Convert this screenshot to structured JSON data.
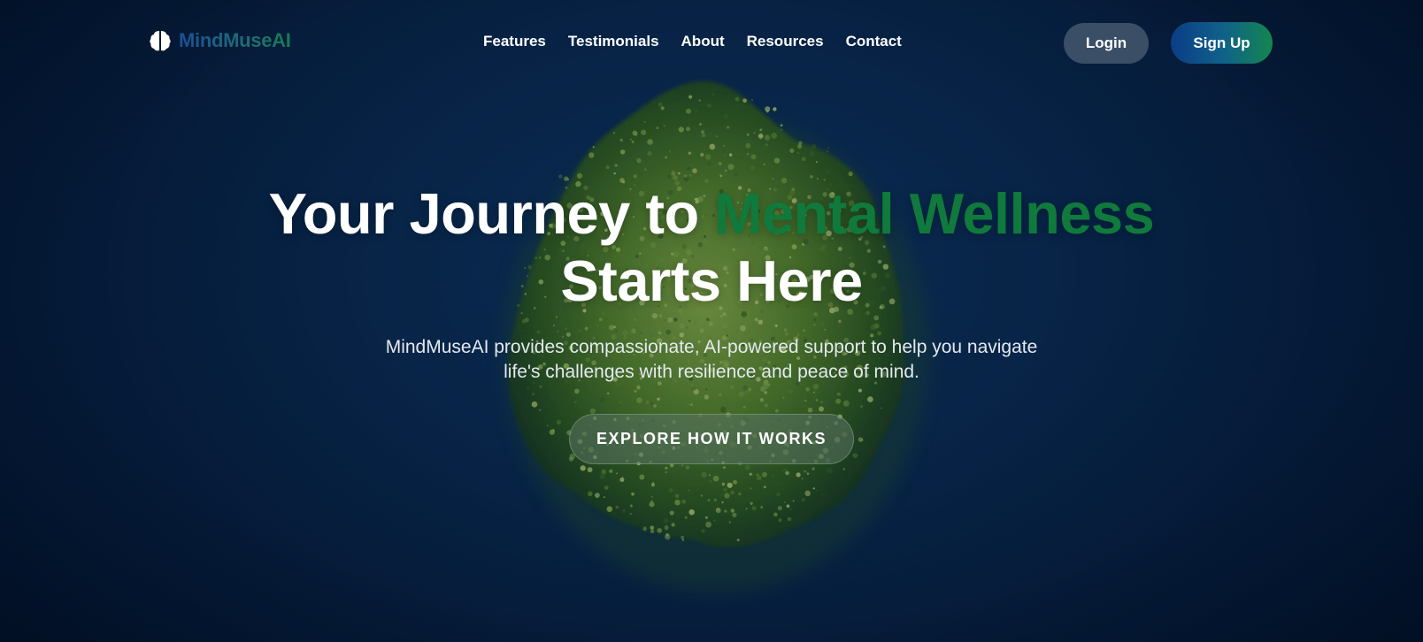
{
  "brand": {
    "name": "MindMuseAI",
    "logo_icon": "brain-icon"
  },
  "nav": {
    "items": [
      {
        "label": "Features"
      },
      {
        "label": "Testimonials"
      },
      {
        "label": "About"
      },
      {
        "label": "Resources"
      },
      {
        "label": "Contact"
      }
    ]
  },
  "auth": {
    "login_label": "Login",
    "signup_label": "Sign Up"
  },
  "hero": {
    "title_part1": "Your Journey to ",
    "title_accent": "Mental Wellness",
    "title_line2": "Starts Here",
    "subtitle_line1": "MindMuseAI provides compassionate, AI-powered support to help you navigate",
    "subtitle_line2": "life's challenges with resilience and peace of mind.",
    "cta_label": "EXPLORE HOW IT WORKS",
    "background_image": "green-moss-tree-illustration"
  },
  "colors": {
    "background": "#0a2a51",
    "accent_green": "#0f7a3c",
    "brand_blue": "#1c4f92",
    "login_bg": "#3a4e66"
  }
}
